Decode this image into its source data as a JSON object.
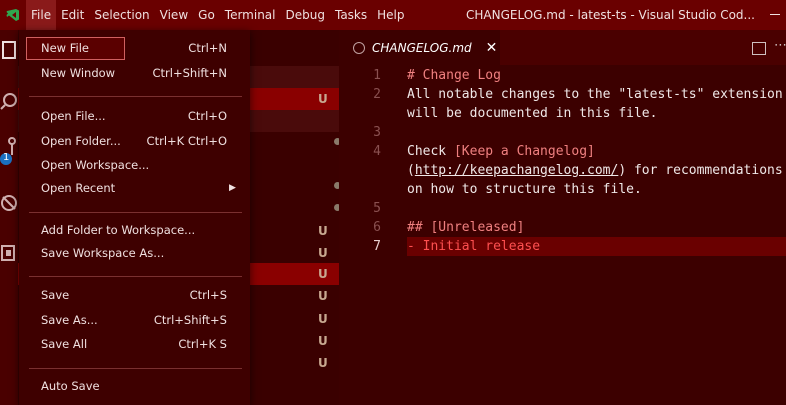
{
  "menubar": {
    "items": [
      "File",
      "Edit",
      "Selection",
      "View",
      "Go",
      "Terminal",
      "Debug",
      "Tasks",
      "Help"
    ],
    "window_title": "CHANGELOG.md - latest-ts - Visual Studio Cod..."
  },
  "activity": {
    "icons": [
      "files-icon",
      "search-icon",
      "source-control-icon",
      "debug-icon",
      "extensions-icon"
    ],
    "badge": "1"
  },
  "sidebar": {
    "git_markers": [
      "U",
      "●",
      "●",
      "●",
      "U",
      "U",
      "U",
      "U",
      "U",
      "U",
      "U"
    ]
  },
  "file_menu": {
    "items": [
      {
        "label": "New File",
        "shortcut": "Ctrl+N"
      },
      {
        "label": "New Window",
        "shortcut": "Ctrl+Shift+N"
      },
      {
        "label": "Open File...",
        "shortcut": "Ctrl+O"
      },
      {
        "label": "Open Folder...",
        "shortcut": "Ctrl+K Ctrl+O"
      },
      {
        "label": "Open Workspace...",
        "shortcut": ""
      },
      {
        "label": "Open Recent",
        "shortcut": ""
      },
      {
        "label": "Add Folder to Workspace...",
        "shortcut": ""
      },
      {
        "label": "Save Workspace As...",
        "shortcut": ""
      },
      {
        "label": "Save",
        "shortcut": "Ctrl+S"
      },
      {
        "label": "Save As...",
        "shortcut": "Ctrl+Shift+S"
      },
      {
        "label": "Save All",
        "shortcut": "Ctrl+K S"
      },
      {
        "label": "Auto Save",
        "shortcut": ""
      }
    ]
  },
  "editor": {
    "tab_title": "CHANGELOG.md",
    "line_numbers": [
      "1",
      "2",
      "3",
      "4",
      "5",
      "6",
      "7"
    ],
    "lines": {
      "l1": "# Change Log",
      "l2a": "All notable changes to the \"latest-ts\" extension",
      "l2b": "will be documented in this file.",
      "l4a_pre": "Check ",
      "l4a_link": "[Keep a Changelog]",
      "l4b_pre": "(",
      "l4b_url": "http://keepachangelog.com/",
      "l4b_post": ") for recommendations",
      "l4c": "on how to structure this file.",
      "l6": "## [Unreleased]",
      "l7": "- Initial release"
    }
  },
  "colors": {
    "titlebar": "#6a0000",
    "editor_bg": "#3c0000",
    "current_line": "#6a0000"
  }
}
